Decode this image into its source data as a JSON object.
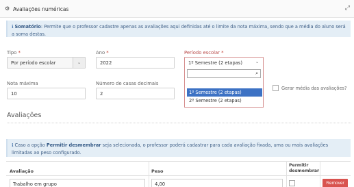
{
  "header": {
    "title": "Avaliações numéricas",
    "gear_icon": "⚙",
    "expand_icon": "⤢"
  },
  "info1": {
    "icon": "ℹ",
    "bold": "Somatório",
    "text": ": Permite que o professor cadastre apenas as avaliações aqui definidas até o limite da nota máxima, sendo que a média do aluno será a soma destas."
  },
  "form": {
    "tipo": {
      "label": "Tipo",
      "required": "*",
      "value": "Por período escolar"
    },
    "ano": {
      "label": "Ano",
      "required": "*",
      "value": "2022"
    },
    "periodo": {
      "label": "Período escolar",
      "required": "*",
      "value": "1º Semestre (2 etapas)",
      "options": [
        "1º Semestre (2 etapas)",
        "2º Semestre (2 etapas)"
      ],
      "selected_option": "1º Semestre (2 etapas)"
    },
    "nota_maxima": {
      "label": "Nota máxima",
      "value": "10"
    },
    "casas_decimais": {
      "label": "Número de casas decimais",
      "value": "2"
    },
    "gerar_media": {
      "label": "Gerar média das avaliações?",
      "checked": false
    }
  },
  "avaliacoes": {
    "title": "Avaliações",
    "info": {
      "icon": "ℹ",
      "pre": "Caso a opção ",
      "bold": "Permitir desmembrar",
      "text": " seja selecionada, o professor poderá cadastrar para cada avaliação fixada, uma ou mais avaliações limitadas ao peso configurado."
    },
    "columns": [
      "Avaliação",
      "Peso",
      "Permitir desmembrar"
    ],
    "rows": [
      {
        "avaliacao": "Trabalho em grupo",
        "peso": "4,00",
        "permitir": false,
        "remove_label": "Remover"
      }
    ]
  },
  "colors": {
    "info_bg": "#e4eef6",
    "selected": "#3d72c4",
    "remove": "#d9534f",
    "required": "#c0392b"
  }
}
